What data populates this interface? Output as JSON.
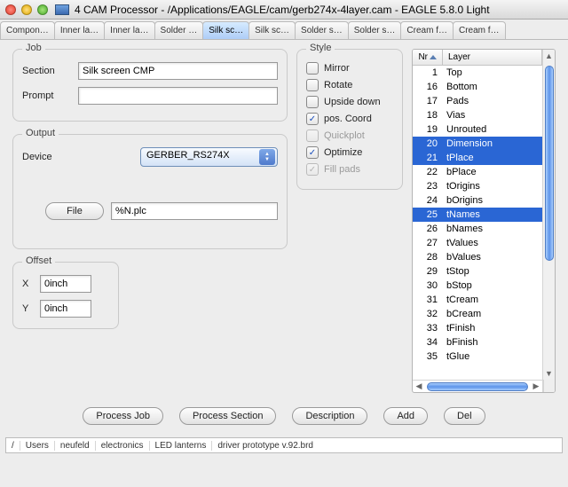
{
  "window": {
    "title": "4 CAM Processor - /Applications/EAGLE/cam/gerb274x-4layer.cam - EAGLE 5.8.0 Light"
  },
  "tabs": [
    {
      "label": "Compon…",
      "active": false
    },
    {
      "label": "Inner la…",
      "active": false
    },
    {
      "label": "Inner la…",
      "active": false
    },
    {
      "label": "Solder …",
      "active": false
    },
    {
      "label": "Silk sc…",
      "active": true
    },
    {
      "label": "Silk sc…",
      "active": false
    },
    {
      "label": "Solder s…",
      "active": false
    },
    {
      "label": "Solder s…",
      "active": false
    },
    {
      "label": "Cream f…",
      "active": false
    },
    {
      "label": "Cream f…",
      "active": false
    }
  ],
  "job": {
    "title": "Job",
    "section_label": "Section",
    "section_value": "Silk screen CMP",
    "prompt_label": "Prompt",
    "prompt_value": ""
  },
  "output": {
    "title": "Output",
    "device_label": "Device",
    "device_value": "GERBER_RS274X",
    "file_button": "File",
    "file_value": "%N.plc"
  },
  "offset": {
    "title": "Offset",
    "x_label": "X",
    "x_value": "0inch",
    "y_label": "Y",
    "y_value": "0inch"
  },
  "style": {
    "title": "Style",
    "options": [
      {
        "label": "Mirror",
        "checked": false,
        "disabled": false
      },
      {
        "label": "Rotate",
        "checked": false,
        "disabled": false
      },
      {
        "label": "Upside down",
        "checked": false,
        "disabled": false
      },
      {
        "label": "pos. Coord",
        "checked": true,
        "disabled": false
      },
      {
        "label": "Quickplot",
        "checked": false,
        "disabled": true
      },
      {
        "label": "Optimize",
        "checked": true,
        "disabled": false
      },
      {
        "label": "Fill pads",
        "checked": true,
        "disabled": true
      }
    ]
  },
  "layers": {
    "header_nr": "Nr",
    "header_layer": "Layer",
    "rows": [
      {
        "nr": "1",
        "name": "Top",
        "sel": false
      },
      {
        "nr": "16",
        "name": "Bottom",
        "sel": false
      },
      {
        "nr": "17",
        "name": "Pads",
        "sel": false
      },
      {
        "nr": "18",
        "name": "Vias",
        "sel": false
      },
      {
        "nr": "19",
        "name": "Unrouted",
        "sel": false
      },
      {
        "nr": "20",
        "name": "Dimension",
        "sel": true
      },
      {
        "nr": "21",
        "name": "tPlace",
        "sel": true
      },
      {
        "nr": "22",
        "name": "bPlace",
        "sel": false
      },
      {
        "nr": "23",
        "name": "tOrigins",
        "sel": false
      },
      {
        "nr": "24",
        "name": "bOrigins",
        "sel": false
      },
      {
        "nr": "25",
        "name": "tNames",
        "sel": true
      },
      {
        "nr": "26",
        "name": "bNames",
        "sel": false
      },
      {
        "nr": "27",
        "name": "tValues",
        "sel": false
      },
      {
        "nr": "28",
        "name": "bValues",
        "sel": false
      },
      {
        "nr": "29",
        "name": "tStop",
        "sel": false
      },
      {
        "nr": "30",
        "name": "bStop",
        "sel": false
      },
      {
        "nr": "31",
        "name": "tCream",
        "sel": false
      },
      {
        "nr": "32",
        "name": "bCream",
        "sel": false
      },
      {
        "nr": "33",
        "name": "tFinish",
        "sel": false
      },
      {
        "nr": "34",
        "name": "bFinish",
        "sel": false
      },
      {
        "nr": "35",
        "name": "tGlue",
        "sel": false
      }
    ]
  },
  "buttons": {
    "process_job": "Process Job",
    "process_section": "Process Section",
    "description": "Description",
    "add": "Add",
    "del": "Del"
  },
  "breadcrumbs": [
    "Users",
    "neufeld",
    "electronics",
    "LED lanterns",
    "driver prototype v.92.brd"
  ]
}
